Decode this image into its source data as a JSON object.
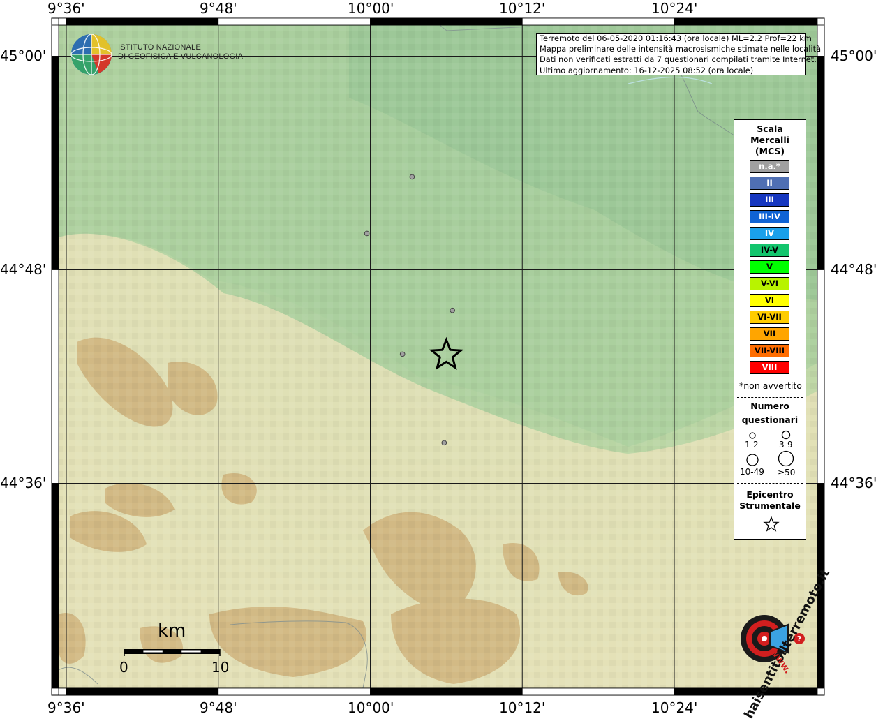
{
  "header": {
    "logo_line1": "ISTITUTO NAZIONALE",
    "logo_line2": "DI GEOFISICA E VULCANOLOGIA"
  },
  "info": {
    "line1": "Terremoto del 06-05-2020 01:16:43 (ora locale) ML=2.2 Prof=22 km",
    "line2": "Mappa preliminare delle intensità macrosismiche stimate nelle località",
    "line3": "Dati non verificati estratti da 7 questionari compilati tramite Internet.",
    "line4": "Ultimo aggiornamento: 16-12-2025 08:52 (ora locale)"
  },
  "axes": {
    "lon_ticks": [
      "9°36'",
      "9°48'",
      "10°00'",
      "10°12'",
      "10°24'"
    ],
    "lat_ticks": [
      "45°00'",
      "44°48'",
      "44°36'"
    ]
  },
  "legend": {
    "title_line1": "Scala",
    "title_line2": "Mercalli",
    "title_line3": "(MCS)",
    "levels": [
      {
        "label": "n.a.*",
        "color": "#a0a0a0",
        "text_color": "#ffffff"
      },
      {
        "label": "II",
        "color": "#4f6fb3",
        "text_color": "#ffffff"
      },
      {
        "label": "III",
        "color": "#1637c0",
        "text_color": "#ffffff"
      },
      {
        "label": "III-IV",
        "color": "#0f63d4",
        "text_color": "#ffffff"
      },
      {
        "label": "IV",
        "color": "#1aa0ea",
        "text_color": "#ffffff"
      },
      {
        "label": "IV-V",
        "color": "#13c56d",
        "text_color": "#000000"
      },
      {
        "label": "V",
        "color": "#00ff00",
        "text_color": "#000000"
      },
      {
        "label": "V-VI",
        "color": "#b8f300",
        "text_color": "#000000"
      },
      {
        "label": "VI",
        "color": "#ffff00",
        "text_color": "#000000"
      },
      {
        "label": "VI-VII",
        "color": "#ffcc00",
        "text_color": "#000000"
      },
      {
        "label": "VII",
        "color": "#ffa500",
        "text_color": "#000000"
      },
      {
        "label": "VII-VIII",
        "color": "#ff6d00",
        "text_color": "#000000"
      },
      {
        "label": "VIII",
        "color": "#ff0000",
        "text_color": "#ffffff"
      }
    ],
    "not_felt_note": "*non avvertito",
    "count_title_line1": "Numero",
    "count_title_line2": "questionari",
    "count_labels": [
      "1-2",
      "3-9",
      "10-49",
      "≥50"
    ],
    "epicenter_title_line1": "Epicentro",
    "epicenter_title_line2": "Strumentale"
  },
  "scale_bar": {
    "unit": "km",
    "start_label": "0",
    "end_label": "10"
  },
  "watermark": {
    "text": "haisentitoilterremoto.it",
    "www": "www."
  },
  "map": {
    "epicenter": {
      "lon": 10.1,
      "lat": 44.72
    },
    "questionnaire_points": [
      {
        "lon": 10.055,
        "lat": 44.887,
        "count_class": "1-2",
        "intensity": "n.a.*"
      },
      {
        "lon": 9.9955,
        "lat": 44.834,
        "count_class": "1-2",
        "intensity": "n.a.*"
      },
      {
        "lon": 10.1081,
        "lat": 44.762,
        "count_class": "1-2",
        "intensity": "n.a.*"
      },
      {
        "lon": 10.0424,
        "lat": 44.721,
        "count_class": "1-2",
        "intensity": "n.a.*"
      },
      {
        "lon": 10.0972,
        "lat": 44.638,
        "count_class": "1-2",
        "intensity": "n.a.*"
      }
    ],
    "extent": {
      "lon_min": 9.58,
      "lon_max": 10.63,
      "lat_min": 44.38,
      "lat_max": 45.06
    }
  }
}
